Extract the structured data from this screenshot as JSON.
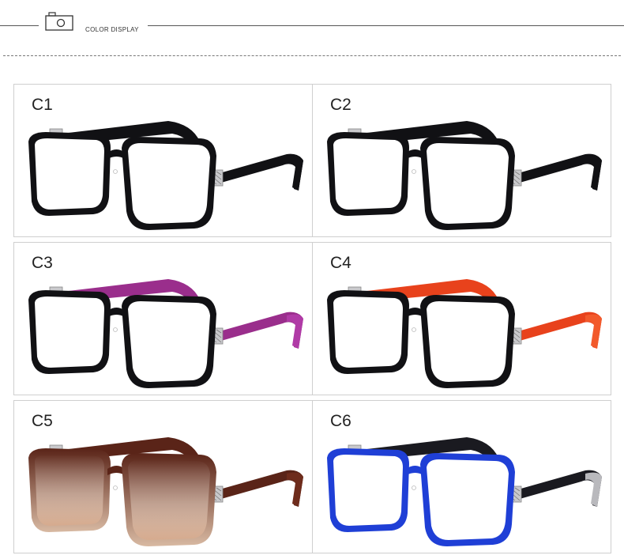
{
  "header": {
    "title": "COLOR DISPLAY",
    "icon": "camera-icon"
  },
  "products": [
    {
      "label": "C1",
      "frame": "#111114",
      "temple": "#111114",
      "tip": "#111114",
      "lens_tint": "none"
    },
    {
      "label": "C2",
      "frame": "#111114",
      "temple": "#111114",
      "tip": "#111114",
      "lens_tint": "none"
    },
    {
      "label": "C3",
      "frame": "#111114",
      "temple": "#9a2e8c",
      "tip": "#b03aa6",
      "lens_tint": "none"
    },
    {
      "label": "C4",
      "frame": "#111114",
      "temple": "#e8421c",
      "tip": "#f25a2c",
      "lens_tint": "none"
    },
    {
      "label": "C5",
      "frame": "#5a2418",
      "temple": "#5a2418",
      "tip": "#6e2c1c",
      "lens_tint": "gradient-brown"
    },
    {
      "label": "C6",
      "frame": "#1f3fd6",
      "temple": "#1a1a20",
      "tip": "#b9b9bd",
      "lens_tint": "none"
    }
  ]
}
